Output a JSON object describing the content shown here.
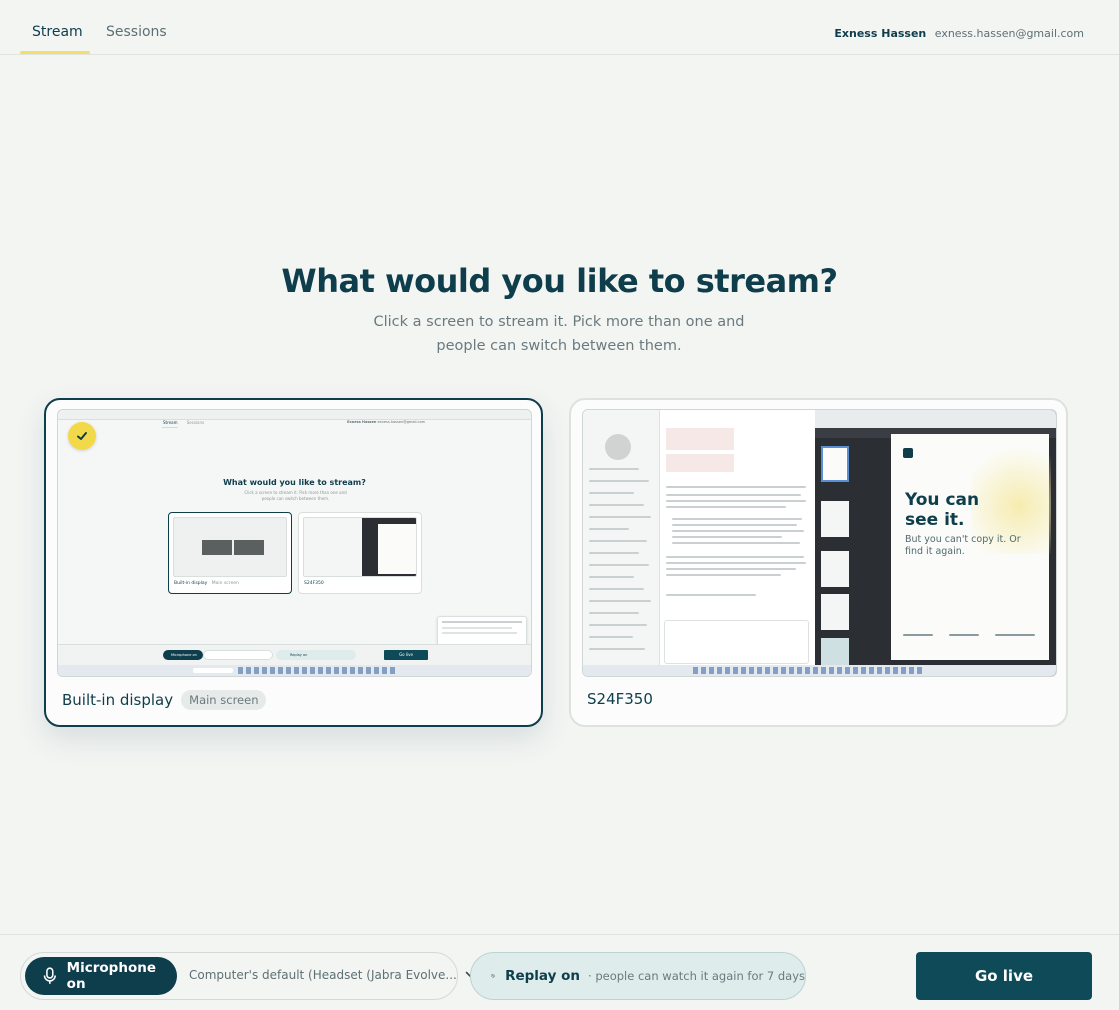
{
  "nav": {
    "tabs": [
      {
        "label": "Stream",
        "active": true
      },
      {
        "label": "Sessions",
        "active": false
      }
    ],
    "user_name": "Exness Hassen",
    "user_email": "exness.hassen@gmail.com"
  },
  "main": {
    "title": "What would you like to stream?",
    "subtitle": "Click a screen to stream it. Pick more than one and people can switch between them.",
    "screens": [
      {
        "name": "Built-in display",
        "badge": "Main screen",
        "selected": true
      },
      {
        "name": "S24F350",
        "badge": "",
        "selected": false
      }
    ]
  },
  "preview1": {
    "title": "What would you like to stream?",
    "subtitle": "Click a screen to stream it. Pick more than one and people can switch between them.",
    "card1_label": "Built-in display",
    "card1_badge": "Main screen",
    "card2_label": "S24F350",
    "mic_label": "Microphone on",
    "replay_label": "Replay on",
    "golive_label": "Go live"
  },
  "preview2": {
    "page_big": "You can see it.",
    "page_sub": "But you can't copy it. Or find it again."
  },
  "bottom": {
    "mic_label": "Microphone on",
    "mic_device": "Computer's default (Headset (Jabra Evolve...",
    "replay_label": "Replay on",
    "replay_desc": "· people can watch it again for 7 days",
    "golive_label": "Go live"
  },
  "colors": {
    "primary": "#0e3d4b",
    "accent": "#f2df6a",
    "background": "#f3f5f3"
  }
}
